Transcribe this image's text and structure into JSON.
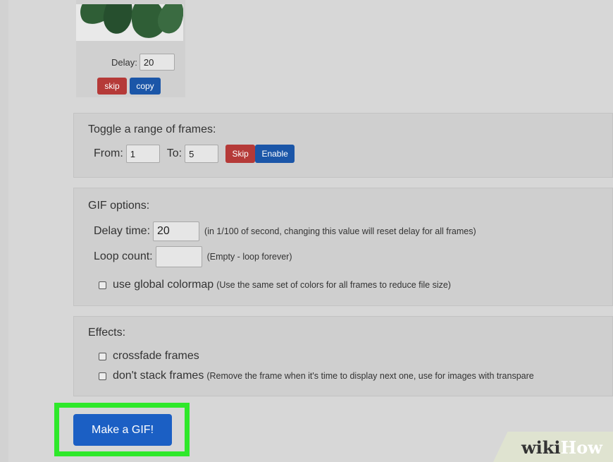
{
  "frame": {
    "delay_label": "Delay:",
    "delay_value": "20",
    "skip_label": "skip",
    "copy_label": "copy"
  },
  "toggle_range": {
    "title": "Toggle a range of frames:",
    "from_label": "From:",
    "from_value": "1",
    "to_label": "To:",
    "to_value": "5",
    "skip_label": "Skip",
    "enable_label": "Enable"
  },
  "gif_options": {
    "title": "GIF options:",
    "delay_label": "Delay time:",
    "delay_value": "20",
    "delay_hint": "(in 1/100 of second, changing this value will reset delay for all frames)",
    "loop_label": "Loop count:",
    "loop_value": "",
    "loop_hint": "(Empty - loop forever)",
    "colormap_label": "use global colormap",
    "colormap_hint": "(Use the same set of colors for all frames to reduce file size)"
  },
  "effects": {
    "title": "Effects:",
    "crossfade_label": "crossfade frames",
    "nostack_label": "don't stack frames",
    "nostack_hint": "(Remove the frame when it's time to display next one, use for images with transpare"
  },
  "make_gif_label": "Make a GIF!",
  "watermark": {
    "wiki": "wiki",
    "how": "How"
  },
  "colors": {
    "skip_red": "#b53a38",
    "action_blue": "#1b56a8",
    "highlight_green": "#2ee82a",
    "make_gif_blue": "#1b5fc4"
  }
}
